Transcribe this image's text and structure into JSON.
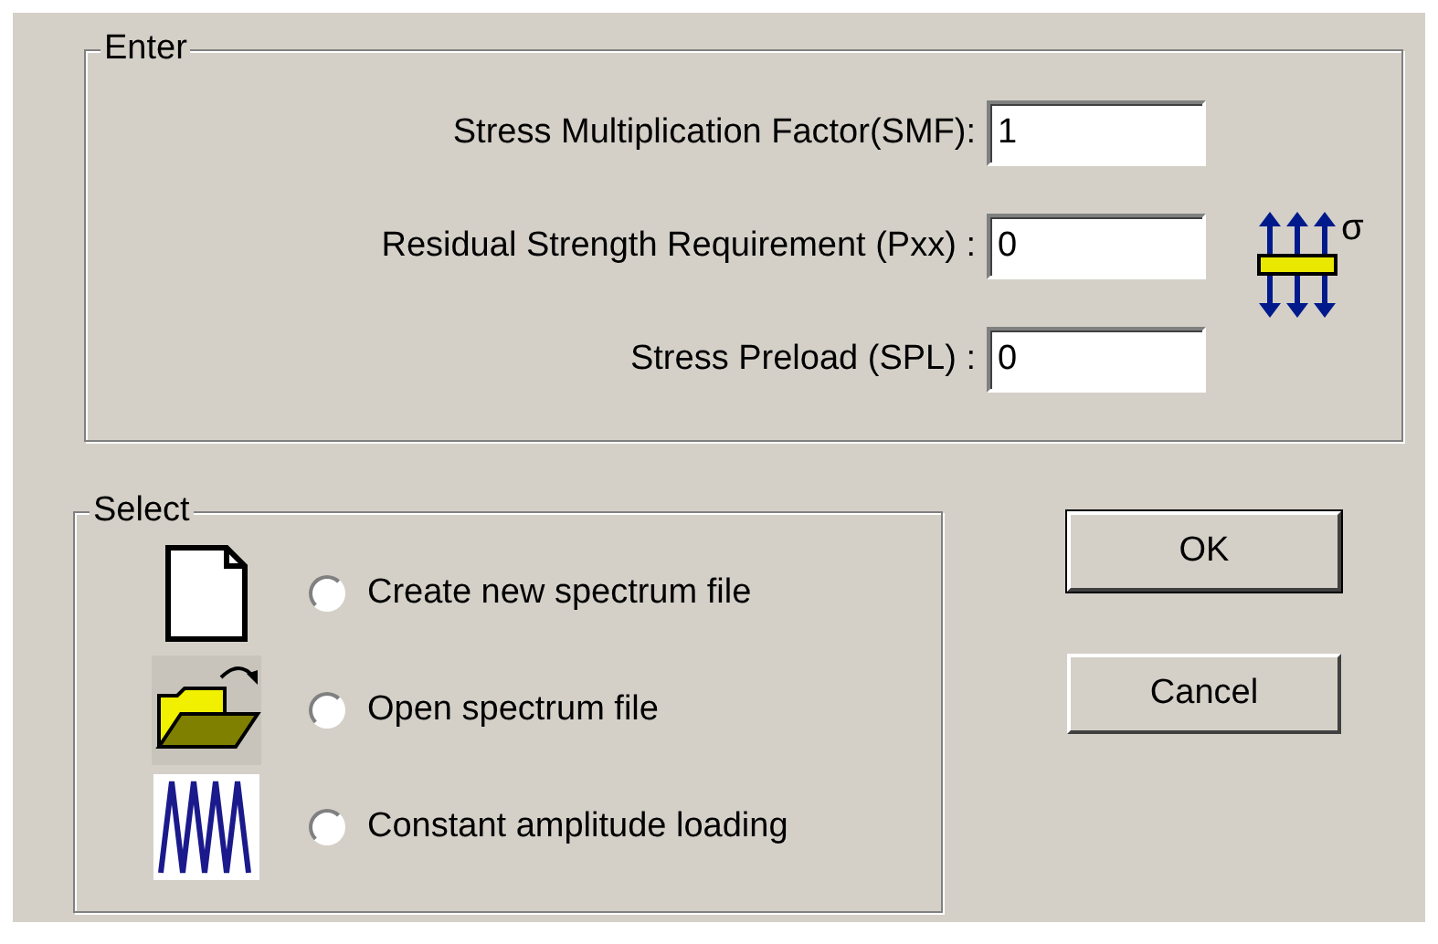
{
  "enter_group": {
    "legend": "Enter",
    "fields": [
      {
        "label": "Stress Multiplication Factor(SMF):",
        "value": "1"
      },
      {
        "label": "Residual Strength Requirement (Pxx) :",
        "value": "0"
      },
      {
        "label": "Stress Preload (SPL) :",
        "value": "0"
      }
    ],
    "icon_label": "σ"
  },
  "select_group": {
    "legend": "Select",
    "options": [
      {
        "kind": "new",
        "label": "Create new spectrum file",
        "selected": false
      },
      {
        "kind": "open",
        "label": "Open spectrum file",
        "selected": false
      },
      {
        "kind": "wave",
        "label": "Constant amplitude loading",
        "selected": false
      }
    ]
  },
  "buttons": [
    {
      "label": "OK",
      "default": true
    },
    {
      "label": "Cancel",
      "default": false
    }
  ]
}
